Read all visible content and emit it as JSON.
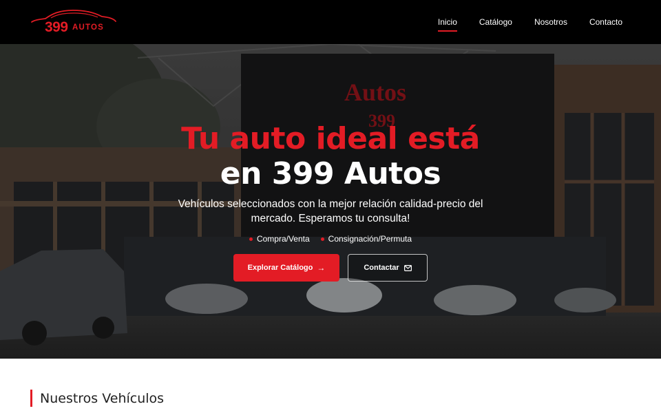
{
  "brand": {
    "logo_number": "399",
    "logo_word": "AUTOS",
    "accent_color": "#e31c25",
    "nav_background": "#000000"
  },
  "nav": {
    "items": [
      {
        "label": "Inicio",
        "active": true
      },
      {
        "label": "Catálogo",
        "active": false
      },
      {
        "label": "Nosotros",
        "active": false
      },
      {
        "label": "Contacto",
        "active": false
      }
    ]
  },
  "hero": {
    "title_line1": "Tu auto ideal está",
    "title_line2": "en 399 Autos",
    "subtitle": "Vehículos seleccionados con la mejor relación calidad-precio del mercado. Esperamos tu consulta!",
    "badges": [
      "Compra/Venta",
      "Consignación/Permuta"
    ],
    "primary_button": {
      "label": "Explorar Catálogo",
      "icon": "arrow-right-icon"
    },
    "secondary_button": {
      "label": "Contactar",
      "icon": "mail-icon"
    },
    "background_image": "dealership-storefront-photo"
  },
  "vehicles_section": {
    "title": "Nuestros Vehículos"
  }
}
